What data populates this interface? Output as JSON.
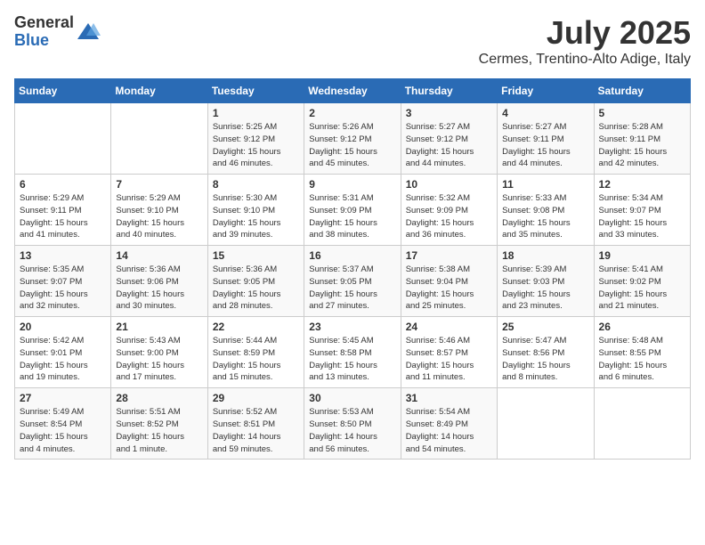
{
  "logo": {
    "general": "General",
    "blue": "Blue"
  },
  "title": {
    "month_year": "July 2025",
    "location": "Cermes, Trentino-Alto Adige, Italy"
  },
  "headers": [
    "Sunday",
    "Monday",
    "Tuesday",
    "Wednesday",
    "Thursday",
    "Friday",
    "Saturday"
  ],
  "weeks": [
    [
      {
        "day": "",
        "info": ""
      },
      {
        "day": "",
        "info": ""
      },
      {
        "day": "1",
        "info": "Sunrise: 5:25 AM\nSunset: 9:12 PM\nDaylight: 15 hours\nand 46 minutes."
      },
      {
        "day": "2",
        "info": "Sunrise: 5:26 AM\nSunset: 9:12 PM\nDaylight: 15 hours\nand 45 minutes."
      },
      {
        "day": "3",
        "info": "Sunrise: 5:27 AM\nSunset: 9:12 PM\nDaylight: 15 hours\nand 44 minutes."
      },
      {
        "day": "4",
        "info": "Sunrise: 5:27 AM\nSunset: 9:11 PM\nDaylight: 15 hours\nand 44 minutes."
      },
      {
        "day": "5",
        "info": "Sunrise: 5:28 AM\nSunset: 9:11 PM\nDaylight: 15 hours\nand 42 minutes."
      }
    ],
    [
      {
        "day": "6",
        "info": "Sunrise: 5:29 AM\nSunset: 9:11 PM\nDaylight: 15 hours\nand 41 minutes."
      },
      {
        "day": "7",
        "info": "Sunrise: 5:29 AM\nSunset: 9:10 PM\nDaylight: 15 hours\nand 40 minutes."
      },
      {
        "day": "8",
        "info": "Sunrise: 5:30 AM\nSunset: 9:10 PM\nDaylight: 15 hours\nand 39 minutes."
      },
      {
        "day": "9",
        "info": "Sunrise: 5:31 AM\nSunset: 9:09 PM\nDaylight: 15 hours\nand 38 minutes."
      },
      {
        "day": "10",
        "info": "Sunrise: 5:32 AM\nSunset: 9:09 PM\nDaylight: 15 hours\nand 36 minutes."
      },
      {
        "day": "11",
        "info": "Sunrise: 5:33 AM\nSunset: 9:08 PM\nDaylight: 15 hours\nand 35 minutes."
      },
      {
        "day": "12",
        "info": "Sunrise: 5:34 AM\nSunset: 9:07 PM\nDaylight: 15 hours\nand 33 minutes."
      }
    ],
    [
      {
        "day": "13",
        "info": "Sunrise: 5:35 AM\nSunset: 9:07 PM\nDaylight: 15 hours\nand 32 minutes."
      },
      {
        "day": "14",
        "info": "Sunrise: 5:36 AM\nSunset: 9:06 PM\nDaylight: 15 hours\nand 30 minutes."
      },
      {
        "day": "15",
        "info": "Sunrise: 5:36 AM\nSunset: 9:05 PM\nDaylight: 15 hours\nand 28 minutes."
      },
      {
        "day": "16",
        "info": "Sunrise: 5:37 AM\nSunset: 9:05 PM\nDaylight: 15 hours\nand 27 minutes."
      },
      {
        "day": "17",
        "info": "Sunrise: 5:38 AM\nSunset: 9:04 PM\nDaylight: 15 hours\nand 25 minutes."
      },
      {
        "day": "18",
        "info": "Sunrise: 5:39 AM\nSunset: 9:03 PM\nDaylight: 15 hours\nand 23 minutes."
      },
      {
        "day": "19",
        "info": "Sunrise: 5:41 AM\nSunset: 9:02 PM\nDaylight: 15 hours\nand 21 minutes."
      }
    ],
    [
      {
        "day": "20",
        "info": "Sunrise: 5:42 AM\nSunset: 9:01 PM\nDaylight: 15 hours\nand 19 minutes."
      },
      {
        "day": "21",
        "info": "Sunrise: 5:43 AM\nSunset: 9:00 PM\nDaylight: 15 hours\nand 17 minutes."
      },
      {
        "day": "22",
        "info": "Sunrise: 5:44 AM\nSunset: 8:59 PM\nDaylight: 15 hours\nand 15 minutes."
      },
      {
        "day": "23",
        "info": "Sunrise: 5:45 AM\nSunset: 8:58 PM\nDaylight: 15 hours\nand 13 minutes."
      },
      {
        "day": "24",
        "info": "Sunrise: 5:46 AM\nSunset: 8:57 PM\nDaylight: 15 hours\nand 11 minutes."
      },
      {
        "day": "25",
        "info": "Sunrise: 5:47 AM\nSunset: 8:56 PM\nDaylight: 15 hours\nand 8 minutes."
      },
      {
        "day": "26",
        "info": "Sunrise: 5:48 AM\nSunset: 8:55 PM\nDaylight: 15 hours\nand 6 minutes."
      }
    ],
    [
      {
        "day": "27",
        "info": "Sunrise: 5:49 AM\nSunset: 8:54 PM\nDaylight: 15 hours\nand 4 minutes."
      },
      {
        "day": "28",
        "info": "Sunrise: 5:51 AM\nSunset: 8:52 PM\nDaylight: 15 hours\nand 1 minute."
      },
      {
        "day": "29",
        "info": "Sunrise: 5:52 AM\nSunset: 8:51 PM\nDaylight: 14 hours\nand 59 minutes."
      },
      {
        "day": "30",
        "info": "Sunrise: 5:53 AM\nSunset: 8:50 PM\nDaylight: 14 hours\nand 56 minutes."
      },
      {
        "day": "31",
        "info": "Sunrise: 5:54 AM\nSunset: 8:49 PM\nDaylight: 14 hours\nand 54 minutes."
      },
      {
        "day": "",
        "info": ""
      },
      {
        "day": "",
        "info": ""
      }
    ]
  ]
}
